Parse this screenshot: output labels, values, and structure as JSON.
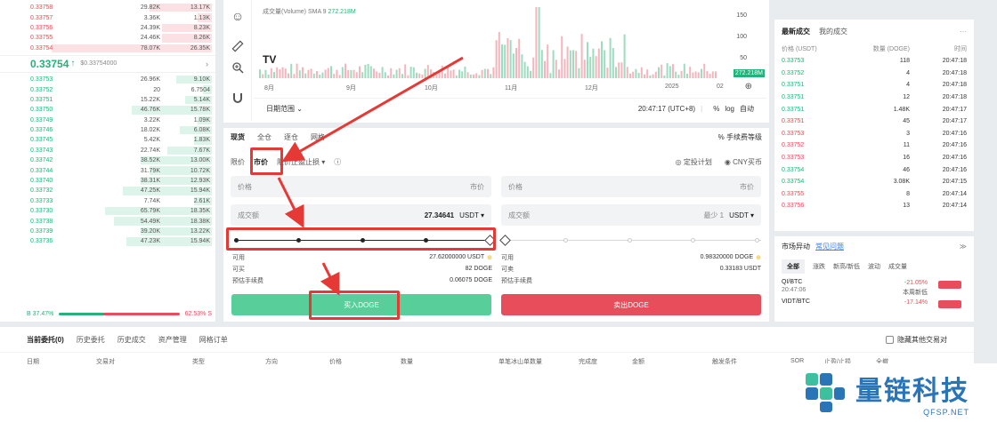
{
  "orderbook": {
    "asks": [
      {
        "p": "0.33758",
        "q": "29.82K",
        "t": "13.17K",
        "w": 0.35
      },
      {
        "p": "0.33757",
        "q": "3.36K",
        "t": "1.13K",
        "w": 0.08
      },
      {
        "p": "0.33756",
        "q": "24.39K",
        "t": "8.23K",
        "w": 0.28
      },
      {
        "p": "0.33755",
        "q": "24.46K",
        "t": "8.26K",
        "w": 0.28
      },
      {
        "p": "0.33754",
        "q": "78.07K",
        "t": "26.35K",
        "w": 0.9
      }
    ],
    "last_price": "0.33754",
    "last_arrow": "↑",
    "ref_price": "$0.33754000",
    "go_icon": "›",
    "bids": [
      {
        "p": "0.33753",
        "q": "26.96K",
        "t": "9.10K",
        "w": 0.2
      },
      {
        "p": "0.33752",
        "q": "20",
        "t": "6.7504",
        "w": 0.05
      },
      {
        "p": "0.33751",
        "q": "15.22K",
        "t": "5.14K",
        "w": 0.15
      },
      {
        "p": "0.33750",
        "q": "46.76K",
        "t": "15.78K",
        "w": 0.45
      },
      {
        "p": "0.33749",
        "q": "3.22K",
        "t": "1.09K",
        "w": 0.08
      },
      {
        "p": "0.33746",
        "q": "18.02K",
        "t": "6.08K",
        "w": 0.18
      },
      {
        "p": "0.33745",
        "q": "5.42K",
        "t": "1.83K",
        "w": 0.1
      },
      {
        "p": "0.33743",
        "q": "22.74K",
        "t": "7.67K",
        "w": 0.25
      },
      {
        "p": "0.33742",
        "q": "38.52K",
        "t": "13.00K",
        "w": 0.4
      },
      {
        "p": "0.33744",
        "q": "31.79K",
        "t": "10.72K",
        "w": 0.35
      },
      {
        "p": "0.33740",
        "q": "38.31K",
        "t": "12.93K",
        "w": 0.4
      },
      {
        "p": "0.33732",
        "q": "47.25K",
        "t": "15.94K",
        "w": 0.5
      },
      {
        "p": "0.33733",
        "q": "7.74K",
        "t": "2.61K",
        "w": 0.1
      },
      {
        "p": "0.33730",
        "q": "65.79K",
        "t": "18.35K",
        "w": 0.6
      },
      {
        "p": "0.33738",
        "q": "54.49K",
        "t": "18.38K",
        "w": 0.55
      },
      {
        "p": "0.33739",
        "q": "39.20K",
        "t": "13.22K",
        "w": 0.4
      },
      {
        "p": "0.33736",
        "q": "47.23K",
        "t": "15.94K",
        "w": 0.48
      }
    ],
    "buy_ratio": "B 37.47%",
    "sell_ratio": "62.53% S"
  },
  "chart": {
    "vol_label": "成交量(Volume) SMA 9",
    "vol_value": "272.218M",
    "months": [
      "8月",
      "9月",
      "10月",
      "11月",
      "12月",
      "2025",
      "02"
    ],
    "y_ticks": [
      "150",
      "100",
      "50"
    ],
    "vol_tag": "272.218M",
    "tv_logo": "TV"
  },
  "toolbar_icons": [
    "smile-icon",
    "ruler-icon",
    "zoom-in-icon",
    "magnet-icon"
  ],
  "date_row": {
    "range": "日期范围",
    "time": "20:47:17 (UTC+8)",
    "pct": "%",
    "log": "log",
    "auto": "自动"
  },
  "trade": {
    "tabs": [
      "现货",
      "全仓",
      "逐仓",
      "网格"
    ],
    "fee": "手续费等级",
    "order_types": [
      "限价",
      "市价",
      "限价止盈止损"
    ],
    "plan": "定投计划",
    "cny": "CNY买币",
    "buy": {
      "price_label": "价格",
      "price_mode": "市价",
      "amount_label": "成交额",
      "amount_value": "27.34641",
      "amount_unit": "USDT",
      "avail_label": "可用",
      "avail_value": "27.62000000 USDT",
      "can_buy_label": "可买",
      "can_buy_value": "82 DOGE",
      "fee_label": "预估手续费",
      "fee_value": "0.06075 DOGE",
      "button": "买入DOGE"
    },
    "sell": {
      "price_label": "价格",
      "price_mode": "市价",
      "amount_label": "成交额",
      "amount_hint": "最少 1",
      "amount_unit": "USDT",
      "avail_label": "可用",
      "avail_value": "0.98320000 DOGE",
      "can_sell_label": "可卖",
      "can_sell_value": "0.33183 USDT",
      "fee_label": "预估手续费",
      "button": "卖出DOGE"
    }
  },
  "recent_trades": {
    "tabs": [
      "最新成交",
      "我的成交"
    ],
    "more": "···",
    "headers": [
      "价格 (USDT)",
      "数量 (DOGE)",
      "时间"
    ],
    "rows": [
      {
        "p": "0.33753",
        "q": "118",
        "t": "20:47:18",
        "side": "up"
      },
      {
        "p": "0.33752",
        "q": "4",
        "t": "20:47:18",
        "side": "up"
      },
      {
        "p": "0.33751",
        "q": "4",
        "t": "20:47:18",
        "side": "up"
      },
      {
        "p": "0.33751",
        "q": "12",
        "t": "20:47:18",
        "side": "up"
      },
      {
        "p": "0.33751",
        "q": "1.48K",
        "t": "20:47:17",
        "side": "up"
      },
      {
        "p": "0.33751",
        "q": "45",
        "t": "20:47:17",
        "side": "dn"
      },
      {
        "p": "0.33753",
        "q": "3",
        "t": "20:47:16",
        "side": "dn"
      },
      {
        "p": "0.33752",
        "q": "11",
        "t": "20:47:16",
        "side": "dn"
      },
      {
        "p": "0.33753",
        "q": "16",
        "t": "20:47:16",
        "side": "dn"
      },
      {
        "p": "0.33754",
        "q": "46",
        "t": "20:47:16",
        "side": "up"
      },
      {
        "p": "0.33754",
        "q": "3.08K",
        "t": "20:47:15",
        "side": "up"
      },
      {
        "p": "0.33755",
        "q": "8",
        "t": "20:47:14",
        "side": "dn"
      },
      {
        "p": "0.33756",
        "q": "13",
        "t": "20:47:14",
        "side": "dn"
      }
    ]
  },
  "market_moves": {
    "title": "市场异动",
    "link": "常见问题",
    "collapse": "≫",
    "tabs": [
      "全部",
      "涨跌",
      "新高/新低",
      "波动",
      "成交量"
    ],
    "rows": [
      {
        "sym": "QI/BTC",
        "time": "20:47:06",
        "pct": "-21.05%",
        "note": "本周新低"
      },
      {
        "sym": "VIDT/BTC",
        "time": "",
        "pct": "-17.14%",
        "note": ""
      }
    ]
  },
  "bottom": {
    "tabs": [
      "当前委托(0)",
      "历史委托",
      "历史成交",
      "资产管理",
      "网格订单"
    ],
    "hide_label": "隐藏其他交易对",
    "cols": [
      "日期",
      "交易对",
      "类型",
      "方向",
      "价格",
      "数量",
      "单笔冰山单数量",
      "完成度",
      "金额",
      "触发条件",
      "SOR",
      "止盈/止损",
      "全撤"
    ]
  },
  "watermark": {
    "cn": "量链科技",
    "en": "QFSP.NET"
  },
  "colors": {
    "up": "#23b27a",
    "down": "#e84d5b",
    "highlight": "#e53935",
    "brand": "#2a74b8"
  }
}
